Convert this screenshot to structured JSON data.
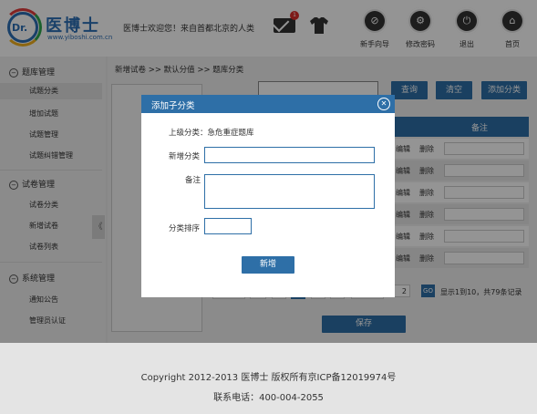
{
  "header": {
    "logo_text": "医博士",
    "logo_badge": "Dr.",
    "logo_url": "www.yiboshi.com.cn",
    "welcome": "医博士欢迎您！来自首都北京的人类",
    "mail_count": "1",
    "nav": [
      {
        "label": "新手向导",
        "icon": "guide-icon",
        "glyph": "⊘"
      },
      {
        "label": "修改密码",
        "icon": "gear-icon",
        "glyph": "⚙"
      },
      {
        "label": "退出",
        "icon": "power-icon",
        "glyph": "⏻"
      },
      {
        "label": "首页",
        "icon": "home-icon",
        "glyph": "⌂"
      }
    ]
  },
  "sidebar": {
    "sections": [
      {
        "title": "题库管理",
        "items": [
          "试题分类",
          "增加试题",
          "试题管理",
          "试题纠错管理"
        ]
      },
      {
        "title": "试卷管理",
        "items": [
          "试卷分类",
          "新增试卷",
          "试卷列表"
        ]
      },
      {
        "title": "系统管理",
        "items": [
          "通知公告",
          "管理员认证"
        ]
      }
    ],
    "active_item": "试题分类",
    "collapse_glyph": "《"
  },
  "main": {
    "breadcrumb": "新增试卷 >> 默认分值 >> 题库分类",
    "buttons": {
      "query": "查询",
      "clear": "清空",
      "add": "添加分类"
    },
    "table_header_note": "备注",
    "row_links": {
      "edit": "编辑",
      "delete": "删除"
    },
    "pager": {
      "page_input": "2",
      "go": "GO",
      "summary": "显示1到10，共79条记录"
    },
    "save": "保存"
  },
  "dialog": {
    "title": "添加子分类",
    "parent_label": "上级分类：急危重症题库",
    "name_label": "新增分类",
    "note_label": "备注",
    "order_label": "分类排序",
    "submit": "新增"
  },
  "footer": {
    "copyright": "Copyright  2012-2013 医博士 版权所有京ICP备12019974号",
    "phone": "联系电话：400-004-2055"
  },
  "colors": {
    "accent": "#2e6fa7",
    "badge": "#d9302b"
  }
}
